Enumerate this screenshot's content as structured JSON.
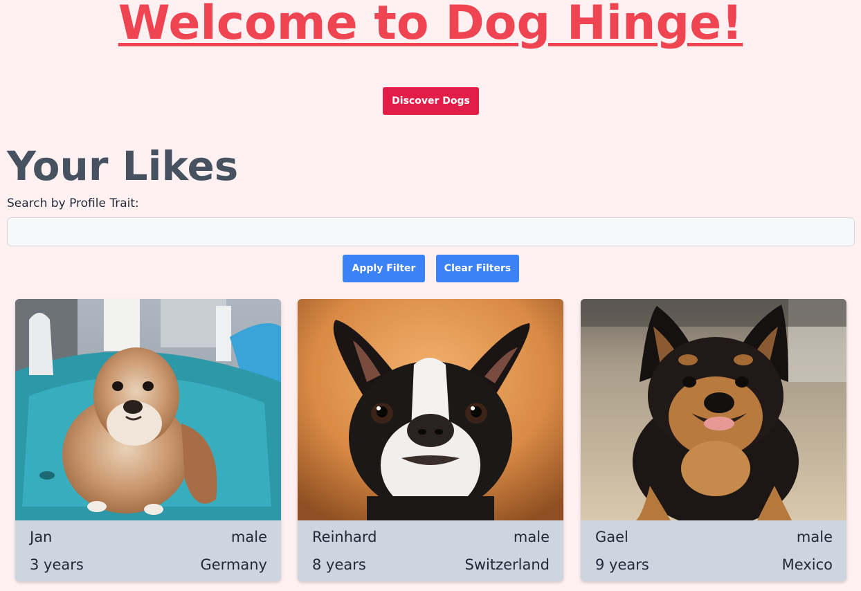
{
  "header": {
    "title": "Welcome to Dog Hinge!",
    "discover_label": "Discover Dogs"
  },
  "likes": {
    "title": "Your Likes",
    "search_label": "Search by Profile Trait:",
    "search_value": "",
    "apply_label": "Apply Filter",
    "clear_label": "Clear Filters"
  },
  "cards": [
    {
      "name": "Jan",
      "gender": "male",
      "age": "3 years",
      "country": "Germany",
      "photo": "pekingese-dog-photo"
    },
    {
      "name": "Reinhard",
      "gender": "male",
      "age": "8 years",
      "country": "Switzerland",
      "photo": "boston-terrier-dog-photo"
    },
    {
      "name": "Gael",
      "gender": "male",
      "age": "9 years",
      "country": "Mexico",
      "photo": "black-tan-spitz-dog-photo"
    }
  ],
  "colors": {
    "background": "#fff1f2",
    "title": "#ef4452",
    "discover_button": "#e11d48",
    "filter_button": "#3b82f6",
    "card_footer": "#cdd5df",
    "heading": "#475261"
  }
}
